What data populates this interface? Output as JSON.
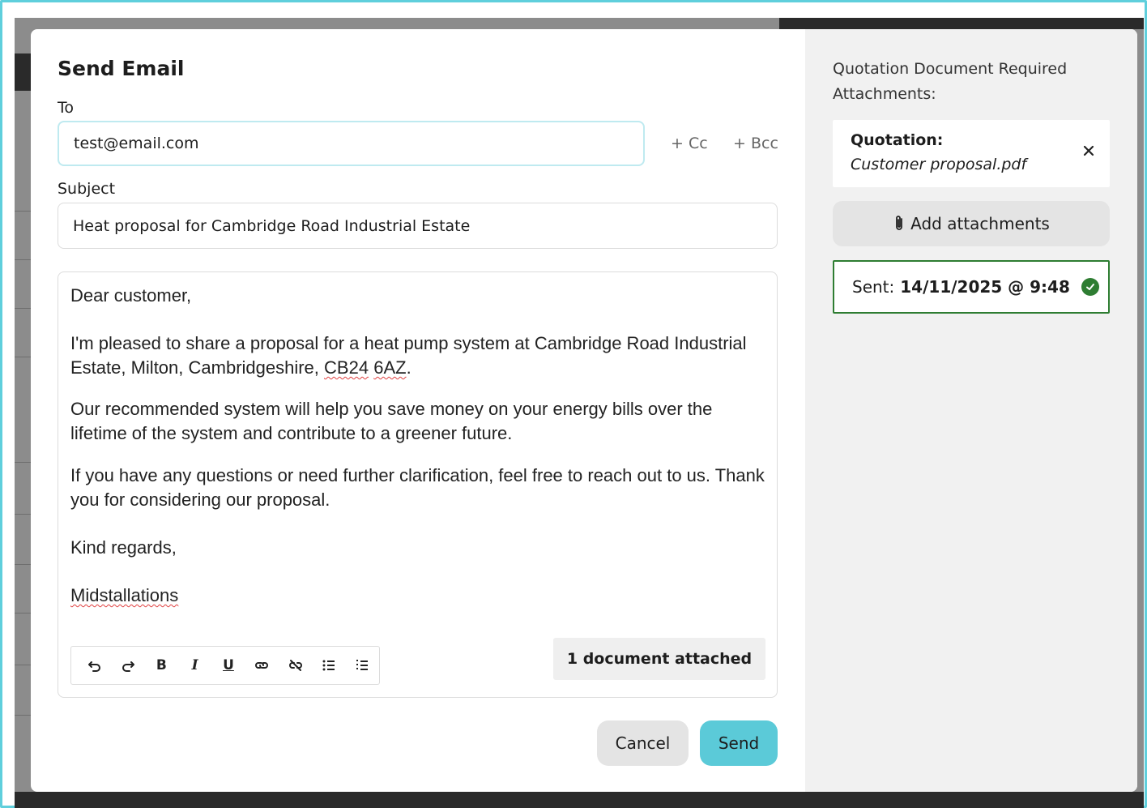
{
  "dialog": {
    "title": "Send Email",
    "to_label": "To",
    "to_value": "test@email.com",
    "cc_label": "+ Cc",
    "bcc_label": "+ Bcc",
    "subject_label": "Subject",
    "subject_value": "Heat proposal for Cambridge Road Industrial Estate"
  },
  "body": {
    "greeting": "Dear customer,",
    "para1_start": "I'm pleased to share a proposal for a heat pump system at Cambridge Road Industrial Estate, Milton, Cambridgeshire, ",
    "para1_postcode_a": "CB24",
    "para1_space": " ",
    "para1_postcode_b": "6AZ",
    "para1_end": ".",
    "para2": "Our recommended system will help you save money on your energy bills over the lifetime of the system and contribute to a greener future.",
    "para3": "If you have any questions or need further clarification, feel free to reach out to us. Thank you for considering our proposal.",
    "signoff": "Kind regards,",
    "signature": "Midstallations"
  },
  "toolbar": {
    "undo_icon": "undo-icon",
    "redo_icon": "redo-icon",
    "bold_label": "B",
    "italic_label": "I",
    "underline_label": "U",
    "link_icon": "link-icon",
    "unlink_icon": "unlink-icon",
    "bullet_list_icon": "bullet-list-icon",
    "numbered_list_icon": "numbered-list-icon"
  },
  "attached_count": "1 document attached",
  "actions": {
    "cancel": "Cancel",
    "send": "Send"
  },
  "side": {
    "heading": "Quotation Document Required Attachments:",
    "attachment_label": "Quotation:",
    "attachment_file": "Customer proposal.pdf",
    "add_attachments": "Add attachments",
    "sent_label": "Sent:",
    "sent_value": "14/11/2025 @ 9:48"
  },
  "colors": {
    "accent": "#5bcad8",
    "success": "#2e7d32",
    "frame": "#5fcfdc"
  }
}
